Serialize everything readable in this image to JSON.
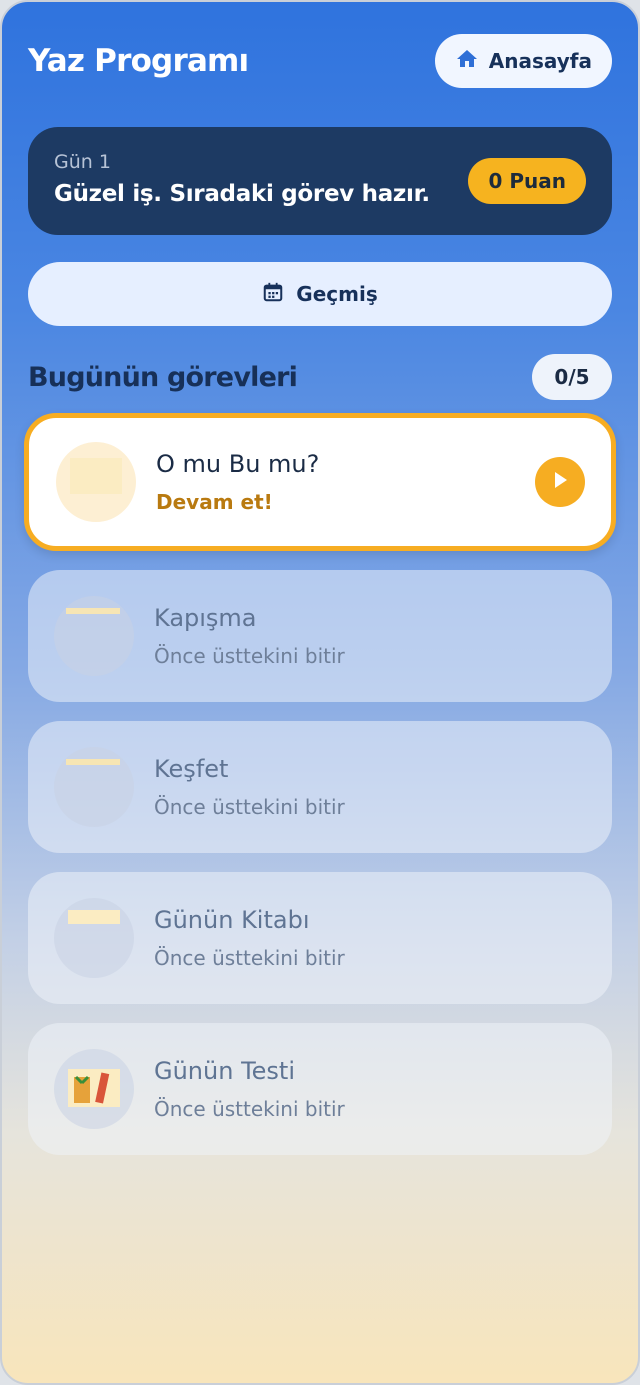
{
  "header": {
    "title": "Yaz Programı",
    "home_label": "Anasayfa"
  },
  "day_card": {
    "day_label": "Gün 1",
    "message": "Güzel iş. Sıradaki görev hazır.",
    "points": "0 Puan"
  },
  "history": {
    "label": "Geçmiş"
  },
  "section": {
    "title": "Bugünün görevleri",
    "progress": "0/5"
  },
  "tasks": [
    {
      "title": "O mu Bu mu?",
      "subtitle": "Devam et!",
      "state": "active"
    },
    {
      "title": "Kapışma",
      "subtitle": "Önce üsttekini bitir",
      "state": "locked"
    },
    {
      "title": "Keşfet",
      "subtitle": "Önce üsttekini bitir",
      "state": "locked"
    },
    {
      "title": "Günün Kitabı",
      "subtitle": "Önce üsttekini bitir",
      "state": "locked"
    },
    {
      "title": "Günün Testi",
      "subtitle": "Önce üsttekini bitir",
      "state": "locked"
    }
  ],
  "icons": {
    "home": "home-icon",
    "calendar": "calendar-icon",
    "play": "play-icon"
  },
  "colors": {
    "accent": "#f6ad22",
    "primary_blue": "#2f73de",
    "dark_navy": "#1d3a63"
  }
}
